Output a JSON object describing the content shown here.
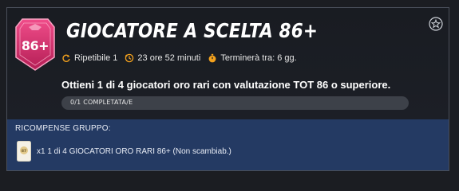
{
  "objective": {
    "badge_text": "86+",
    "title": "GIOCATORE A SCELTA 86+",
    "repeatable": "Ripetibile 1",
    "time_left": "23 ore 52 minuti",
    "ends": "Terminerà tra: 6 gg.",
    "description": "Ottieni 1 di 4 giocatori oro rari con valutazione TOT 86 o superiore.",
    "progress_label": "0/1 COMPLETATA/E",
    "progress_fraction": 0
  },
  "rewards": {
    "heading": "RICOMPENSE GRUPPO:",
    "items": [
      {
        "text": "x1 1 di 4 GIOCATORI ORO RARI 86+ (Non scambiab.)",
        "icon": "player-pick-card-icon"
      }
    ]
  },
  "colors": {
    "accent_pink": "#e8357a",
    "accent_orange": "#f3a11d",
    "rewards_bg": "#243a63"
  }
}
